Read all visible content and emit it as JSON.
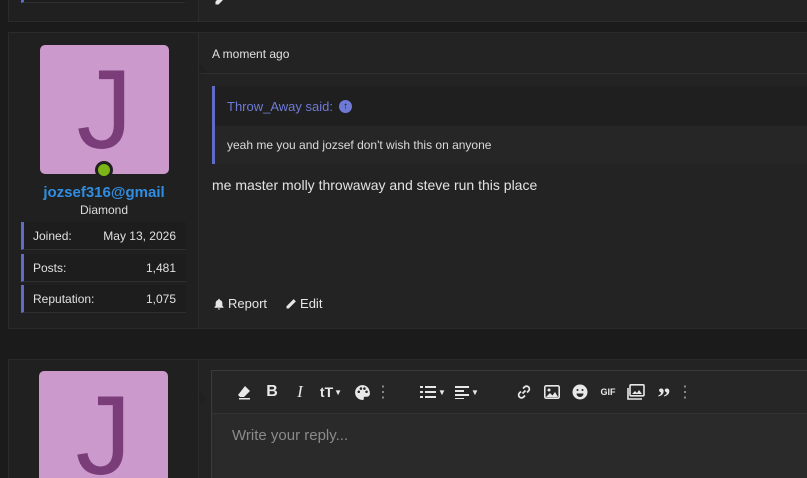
{
  "post": {
    "author": {
      "initial": "J",
      "username": "jozsef316@gmail",
      "rank": "Diamond",
      "stats": [
        {
          "label": "Joined:",
          "value": "May 13, 2026"
        },
        {
          "label": "Posts:",
          "value": "1,481"
        },
        {
          "label": "Reputation:",
          "value": "1,075"
        }
      ]
    },
    "time": "A moment ago",
    "quote": {
      "author_line": "Throw_Away said:",
      "text": "yeah me you and jozsef don't wish this on anyone"
    },
    "text": "me master molly throwaway and steve run this place",
    "actions": {
      "report": "Report",
      "edit": "Edit"
    }
  },
  "reply": {
    "initial": "J",
    "placeholder": "Write your reply...",
    "toolbar": {
      "bold": "B",
      "italic": "I",
      "text_size": "tT",
      "gif": "GIF"
    }
  },
  "colors": {
    "accent": "#5f6bc6",
    "username": "#2f8ee3",
    "avatar_bg": "#cc99cc",
    "online": "#7cb518"
  }
}
